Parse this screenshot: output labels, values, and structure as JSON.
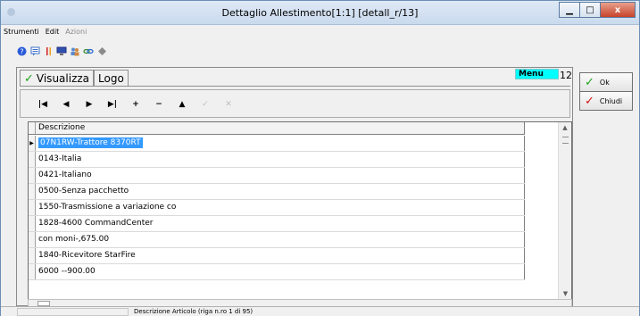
{
  "window": {
    "title": "Dettaglio Allestimento[1:1] [detall_r/13]",
    "minimize": "▁",
    "maximize": "□",
    "close": "x"
  },
  "menu": {
    "items": [
      {
        "label": "Strumenti",
        "enabled": true
      },
      {
        "label": "Edit",
        "enabled": true
      },
      {
        "label": "Azioni",
        "enabled": false
      }
    ]
  },
  "toolbar": {
    "icons": [
      "help-icon",
      "note-icon",
      "bars-icon",
      "monitor-icon",
      "users-icon",
      "link-icon",
      "diamond-icon"
    ]
  },
  "tabs": [
    {
      "label": "Visualizza",
      "active": true
    },
    {
      "label": "Logo",
      "active": false
    }
  ],
  "menu_badge": "Menu",
  "record_count": "12",
  "navigator": {
    "first": "|◀",
    "prev": "◀",
    "next": "▶",
    "last": "▶|",
    "add": "+",
    "remove": "−",
    "up": "▲",
    "confirm": "✓",
    "cancel": "✕"
  },
  "grid": {
    "header": "Descrizione",
    "rows": [
      "07N1RW-Trattore 8370RT",
      "0143-Italia",
      "0421-Italiano",
      "0500-Senza pacchetto",
      "1550-Trasmissione a variazione co",
      "1828-4600 CommandCenter",
      "con moni-,675.00",
      "1840-Ricevitore StarFire",
      "6000 --900.00"
    ],
    "selected_index": 0
  },
  "buttons": {
    "ok": "Ok",
    "chiudi": "Chiudi"
  },
  "status": {
    "text": "Descrizione Articolo (riga n.ro 1 di 95)"
  },
  "colors": {
    "menu_badge_bg": "#00ffff",
    "selection": "#3399ff",
    "ok_check": "#1ca31c",
    "close_check": "#d01414"
  }
}
